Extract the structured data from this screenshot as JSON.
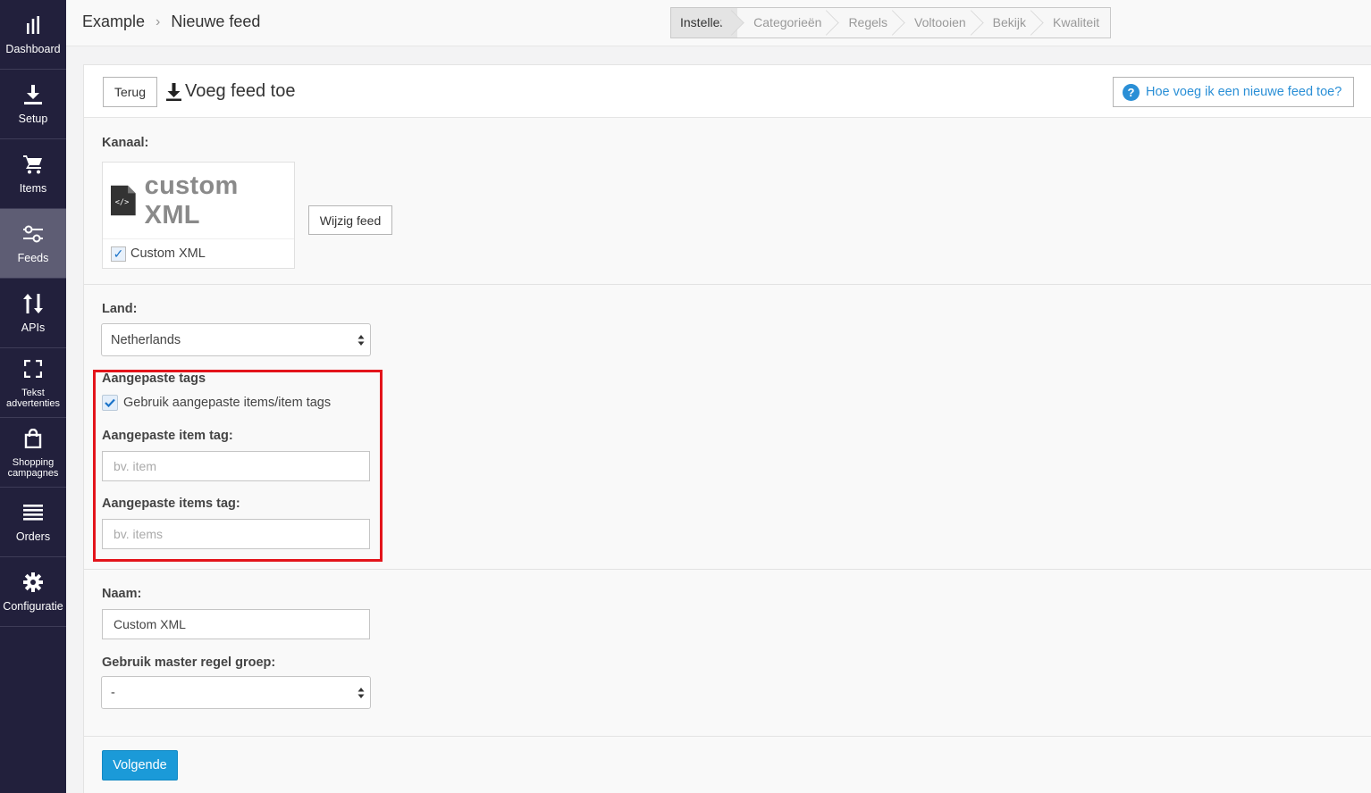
{
  "sidebar": {
    "items": [
      {
        "label": "Dashboard",
        "icon": "bar-chart-icon",
        "active": false
      },
      {
        "label": "Setup",
        "icon": "download-icon",
        "active": false
      },
      {
        "label": "Items",
        "icon": "cart-icon",
        "active": false
      },
      {
        "label": "Feeds",
        "icon": "sliders-icon",
        "active": true
      },
      {
        "label": "APIs",
        "icon": "up-down-arrows-icon",
        "active": false
      },
      {
        "label_line1": "Tekst",
        "label_line2": "advertenties",
        "icon": "frame-corners-icon",
        "active": false
      },
      {
        "label_line1": "Shopping",
        "label_line2": "campagnes",
        "icon": "shopping-bag-icon",
        "active": false
      },
      {
        "label": "Orders",
        "icon": "list-icon",
        "active": false
      },
      {
        "label": "Configuratie",
        "icon": "gear-icon",
        "active": false
      }
    ]
  },
  "breadcrumb": {
    "root": "Example",
    "current": "Nieuwe feed"
  },
  "steps": [
    "Instellen",
    "Categorieën",
    "Regels",
    "Voltooien",
    "Bekijk",
    "Kwaliteit"
  ],
  "header": {
    "back_label": "Terug",
    "title": "Voeg feed toe",
    "help_label": "Hoe voeg ik een nieuwe feed toe?"
  },
  "channel": {
    "label": "Kanaal:",
    "logo_text": "custom XML",
    "logo_badge": "XML",
    "name": "Custom XML",
    "change_label": "Wijzig feed"
  },
  "country": {
    "label": "Land:",
    "value": "Netherlands"
  },
  "custom_tags": {
    "heading": "Aangepaste tags",
    "checkbox_label": "Gebruik aangepaste items/item tags",
    "item_tag_label": "Aangepaste item tag:",
    "item_tag_placeholder": "bv. item",
    "items_tag_label": "Aangepaste items tag:",
    "items_tag_placeholder": "bv. items"
  },
  "name": {
    "label": "Naam:",
    "value": "Custom XML"
  },
  "master_rule": {
    "label": "Gebruik master regel groep:",
    "value": "-"
  },
  "next_label": "Volgende",
  "colors": {
    "sidebar": "#22203c",
    "accent": "#1b9ad8",
    "highlight": "#e3141b"
  }
}
